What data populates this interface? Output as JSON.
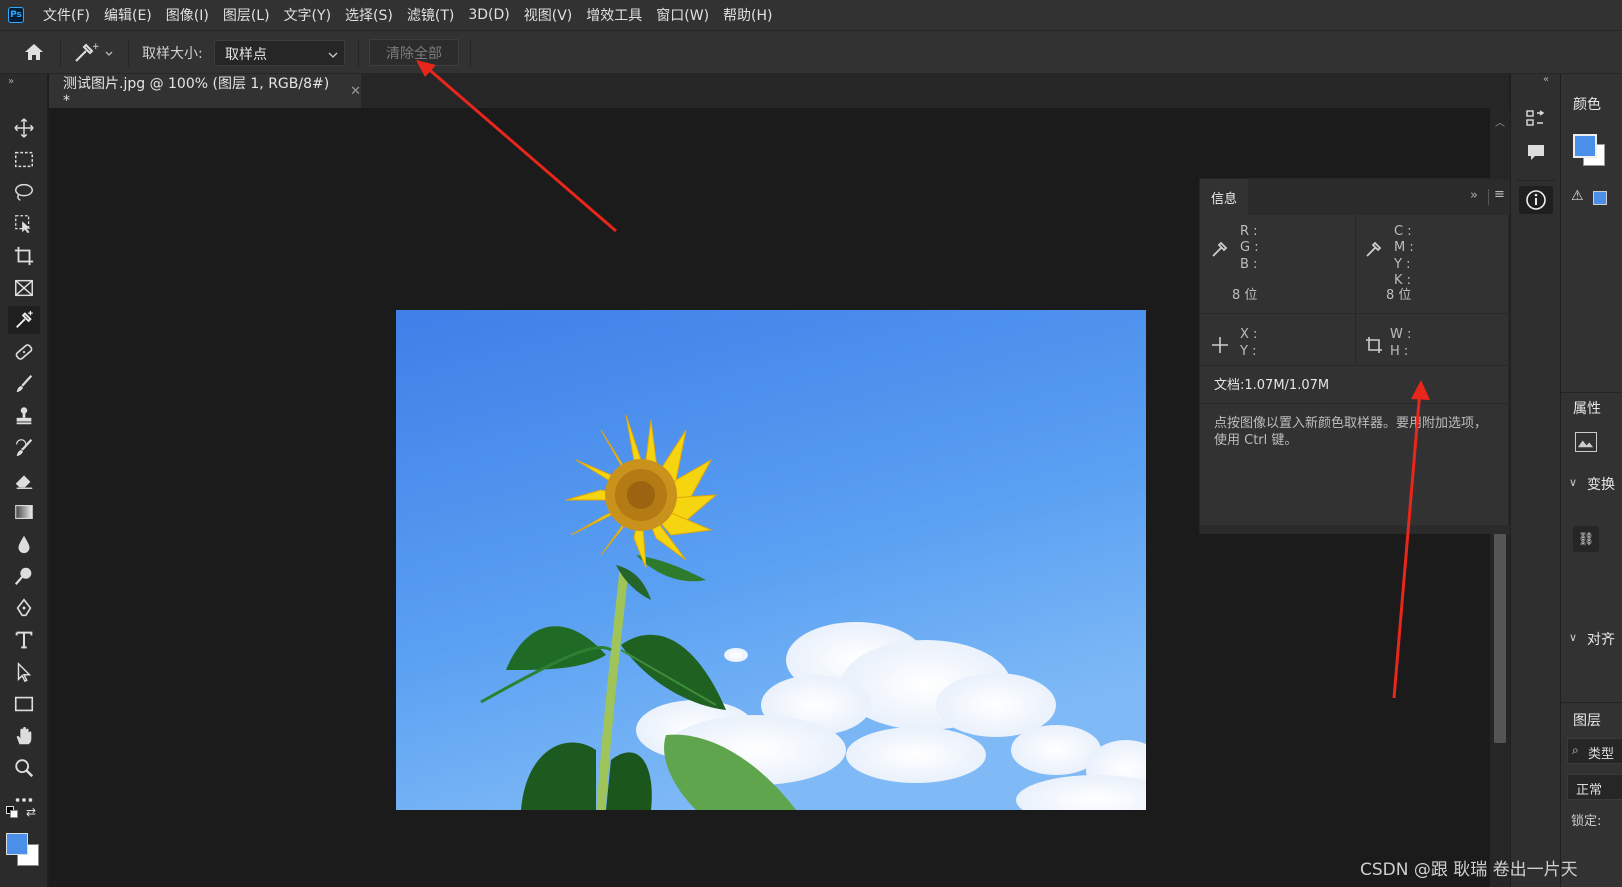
{
  "app": {
    "logo": "Ps",
    "watermark": "CSDN @跟 耿瑞 卷出一片天"
  },
  "menu": [
    "文件(F)",
    "编辑(E)",
    "图像(I)",
    "图层(L)",
    "文字(Y)",
    "选择(S)",
    "滤镜(T)",
    "3D(D)",
    "视图(V)",
    "增效工具",
    "窗口(W)",
    "帮助(H)"
  ],
  "options": {
    "sample_size_label": "取样大小:",
    "sample_size_value": "取样点",
    "clear_all": "清除全部"
  },
  "document": {
    "tab_title": "测试图片.jpg @ 100% (图层 1, RGB/8#) *"
  },
  "info_panel": {
    "tab": "信息",
    "rgb": [
      "R :",
      "G :",
      "B :"
    ],
    "cmyk": [
      "C :",
      "M :",
      "Y :",
      "K :"
    ],
    "bit_left": "8 位",
    "bit_right": "8 位",
    "xy": [
      "X :",
      "Y :"
    ],
    "wh": [
      "W :",
      "H :"
    ],
    "doc_size": "文档:1.07M/1.07M",
    "hint": "点按图像以置入新颜色取样器。要用附加选项，使用 Ctrl 键。"
  },
  "right_panels": {
    "color": "颜色",
    "properties": "属性",
    "transform": "变换",
    "align": "对齐",
    "layers": "图层",
    "layers_search": "类型",
    "blend_mode": "正常",
    "lock": "锁定:"
  },
  "colors": {
    "accent": "#4a90e8",
    "annotation_arrow": "#e8261c"
  }
}
